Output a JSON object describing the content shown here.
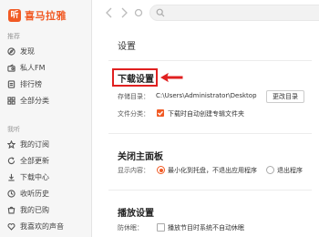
{
  "app": {
    "logo_mark": "听",
    "name": "喜马拉雅"
  },
  "sidebar": {
    "section_recommend": "推荐",
    "recommend_items": [
      {
        "label": "发现",
        "icon": "discover-icon"
      },
      {
        "label": "私人FM",
        "icon": "radio-icon"
      },
      {
        "label": "排行榜",
        "icon": "ranking-icon"
      },
      {
        "label": "全部分类",
        "icon": "category-icon"
      }
    ],
    "section_mine": "我听",
    "mine_items": [
      {
        "label": "我的订阅",
        "icon": "subscribe-icon"
      },
      {
        "label": "全部更新",
        "icon": "update-icon"
      },
      {
        "label": "下载中心",
        "icon": "download-icon"
      },
      {
        "label": "收听历史",
        "icon": "history-icon"
      },
      {
        "label": "我的已购",
        "icon": "purchased-icon"
      },
      {
        "label": "我喜欢的声音",
        "icon": "like-icon"
      }
    ]
  },
  "search": {
    "placeholder": ""
  },
  "settings": {
    "title": "设置",
    "download": {
      "heading": "下载设置",
      "dir_label": "存储目录：",
      "dir_path": "C:\\Users\\Administrator\\Desktop",
      "change_button": "更改目录",
      "category_label": "文件分类：",
      "category_option": "下载时自动创建专辑文件夹",
      "category_checked": true
    },
    "close_panel": {
      "heading": "关闭主面板",
      "display_label": "显示内容：",
      "option_minimize": "最小化到托盘，不退出应用程序",
      "option_exit": "退出程序",
      "selected": "minimize"
    },
    "playback": {
      "heading": "播放设置",
      "sleep_label": "防休眠：",
      "sleep_option": "播放节目时系统不自动休眠",
      "sleep_checked": false
    }
  },
  "annotation": {
    "highlight_color": "#e02020"
  },
  "colors": {
    "accent": "#f15a24",
    "sidebar_bg": "#f6f6f6"
  }
}
